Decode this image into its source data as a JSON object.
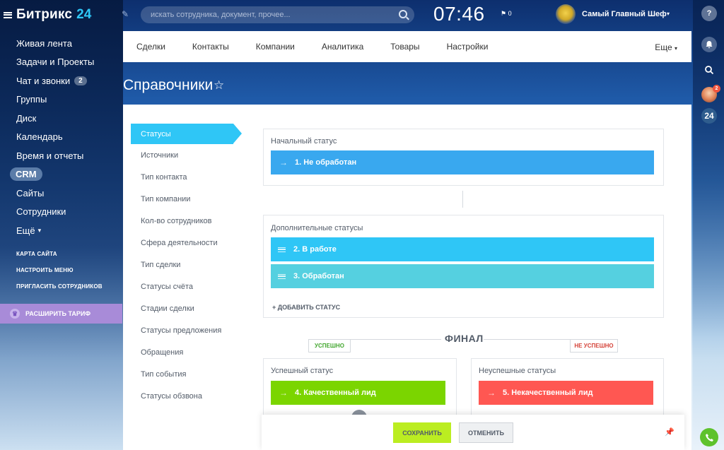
{
  "logo": {
    "text": "Битрикс",
    "num": "24"
  },
  "search": {
    "placeholder": "искать сотрудника, документ, прочее..."
  },
  "header": {
    "clock": "07:46",
    "flag_count": "0",
    "user_name": "Самый Главный Шеф"
  },
  "sidebar": {
    "items": [
      {
        "label": "Живая лента"
      },
      {
        "label": "Задачи и Проекты"
      },
      {
        "label": "Чат и звонки",
        "badge": "2"
      },
      {
        "label": "Группы"
      },
      {
        "label": "Диск"
      },
      {
        "label": "Календарь"
      },
      {
        "label": "Время и отчеты"
      },
      {
        "label": "CRM"
      },
      {
        "label": "Сайты"
      },
      {
        "label": "Сотрудники"
      },
      {
        "label": "Ещё"
      }
    ],
    "links": [
      "КАРТА САЙТА",
      "НАСТРОИТЬ МЕНЮ",
      "ПРИГЛАСИТЬ СОТРУДНИКОВ"
    ],
    "tariff": "РАСШИРИТЬ ТАРИФ"
  },
  "rail": {
    "help": "?",
    "avatar_count": "2",
    "b24": "24"
  },
  "topnav": {
    "tabs": [
      "Сделки",
      "Контакты",
      "Компании",
      "Аналитика",
      "Товары",
      "Настройки"
    ],
    "more": "Еще"
  },
  "page": {
    "title": "Справочники"
  },
  "subnav": [
    "Статусы",
    "Источники",
    "Тип контакта",
    "Тип компании",
    "Кол-во сотрудников",
    "Сфера деятельности",
    "Тип сделки",
    "Статусы счёта",
    "Стадии сделки",
    "Статусы предложения",
    "Обращения",
    "Тип события",
    "Статусы обзвона"
  ],
  "statuses": {
    "initial_title": "Начальный статус",
    "initial": "1. Не обработан",
    "extra_title": "Дополнительные статусы",
    "extra": [
      "2. В работе",
      "3. Обработан"
    ],
    "add_label": "+ ДОБАВИТЬ СТАТУС",
    "final_label": "ФИНАЛ",
    "success_tag": "УСПЕШНО",
    "fail_tag": "НЕ УСПЕШНО",
    "success_title": "Успешный статус",
    "success": "4. Качественный лид",
    "fail_title": "Неуспешные статусы",
    "fail": "5. Некачественный лид"
  },
  "colors": {
    "initial": "#39a8ef",
    "extra_1": "#2fc6f6",
    "extra_2": "#55d0e0",
    "success": "#7bd500",
    "fail": "#ff5752"
  },
  "footer": {
    "save": "СОХРАНИТЬ",
    "cancel": "ОТМЕНИТЬ"
  }
}
